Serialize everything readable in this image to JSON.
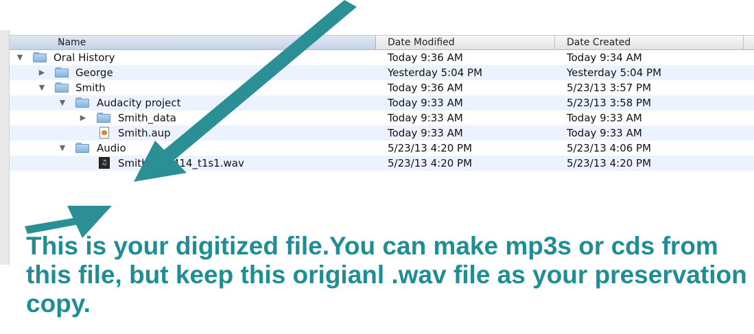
{
  "columns": {
    "name": "Name",
    "modified": "Date Modified",
    "created": "Date Created"
  },
  "rows": [
    {
      "name": "Oral History",
      "modified": "Today 9:36 AM",
      "created": "Today 9:34 AM"
    },
    {
      "name": "George",
      "modified": "Yesterday 5:04 PM",
      "created": "Yesterday 5:04 PM"
    },
    {
      "name": "Smith",
      "modified": "Today 9:36 AM",
      "created": "5/23/13 3:57 PM"
    },
    {
      "name": "Audacity project",
      "modified": "Today 9:33 AM",
      "created": "5/23/13 3:58 PM"
    },
    {
      "name": "Smith_data",
      "modified": "Today 9:33 AM",
      "created": "Today 9:33 AM"
    },
    {
      "name": "Smith.aup",
      "modified": "Today 9:33 AM",
      "created": "Today 9:33 AM"
    },
    {
      "name": "Audio",
      "modified": "5/23/13 4:20 PM",
      "created": "5/23/13 4:06 PM"
    },
    {
      "name": "Smith_900414_t1s1.wav",
      "modified": "5/23/13 4:20 PM",
      "created": "5/23/13 4:20 PM"
    }
  ],
  "caption": {
    "line1": "This is your digitized file.You can make mp3s or cds from",
    "line2": "this file, but keep this origianl .wav file as your preservation",
    "line3": "copy."
  },
  "colors": {
    "accent": "#1f8e94",
    "arrow": "#2b8f96"
  }
}
